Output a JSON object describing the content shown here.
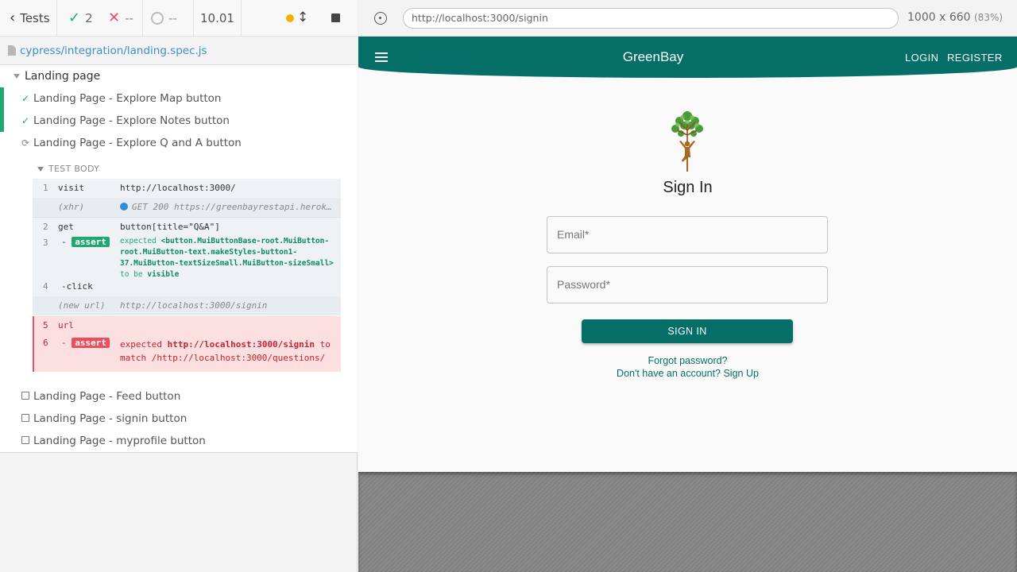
{
  "stats": {
    "tests_label": "Tests",
    "passed": "2",
    "failed": "--",
    "pending": "--",
    "duration": "10.01"
  },
  "spec_path": "cypress/integration/landing.spec.js",
  "suite": {
    "title": "Landing page",
    "tests": [
      {
        "label": "Landing Page - Explore Map button",
        "state": "passed"
      },
      {
        "label": "Landing Page - Explore Notes button",
        "state": "passed"
      },
      {
        "label": "Landing Page - Explore Q and A button",
        "state": "running"
      },
      {
        "label": "Landing Page - Feed button",
        "state": "pending"
      },
      {
        "label": "Landing Page - signin button",
        "state": "pending"
      },
      {
        "label": "Landing Page - myprofile button",
        "state": "pending"
      }
    ]
  },
  "test_body": {
    "header": "TEST BODY",
    "commands": [
      {
        "num": "1",
        "name": "visit",
        "message": "http://localhost:3000/"
      },
      {
        "num": "",
        "name": "(xhr)",
        "message": "GET 200 https://greenbayrestapi.herok…"
      },
      {
        "num": "2",
        "name": "get",
        "message": "button[title=\"Q&A\"]"
      },
      {
        "num": "3",
        "name": "-",
        "badge": "assert",
        "message_expected": "expected",
        "message_subject": "<button.MuiButtonBase-root.MuiButton-root.MuiButton-text.makeStyles-button1-37.MuiButton-textSizeSmall.MuiButton-sizeSmall>",
        "message_tobe": "to be",
        "message_value": "visible"
      },
      {
        "num": "4",
        "name": "-click",
        "message": ""
      },
      {
        "num": "",
        "name": "(new url)",
        "message": "http://localhost:3000/signin"
      },
      {
        "num": "5",
        "name": "url",
        "message": ""
      },
      {
        "num": "6",
        "name": "-",
        "badge": "assert",
        "message_expected": "expected",
        "message_subject": "http://localhost:3000/signin",
        "message_to": "to",
        "message_tail": "match /http://localhost:3000/questions/"
      }
    ]
  },
  "aut": {
    "url": "http://localhost:3000/signin",
    "viewport": "1000 x 660",
    "scale": "(83%)"
  },
  "app": {
    "brand": "GreenBay",
    "nav": [
      "LOGIN",
      "REGISTER"
    ],
    "title": "Sign In",
    "email_label": "Email*",
    "password_label": "Password*",
    "submit_label": "SIGN IN",
    "forgot_link": "Forgot password?",
    "signup_link": "Don't have an account? Sign Up"
  },
  "colors": {
    "brand_green": "#056f67",
    "pass_green": "#1fa971",
    "fail_red": "#e94f5f",
    "link_blue": "#3a91c9"
  },
  "icons": [
    "chevron-left-icon",
    "check-icon",
    "x-icon",
    "circle-icon",
    "running-dot-icon",
    "arrows-icon",
    "stop-icon",
    "file-icon",
    "crosshair-icon",
    "menu-icon",
    "tree-logo"
  ]
}
